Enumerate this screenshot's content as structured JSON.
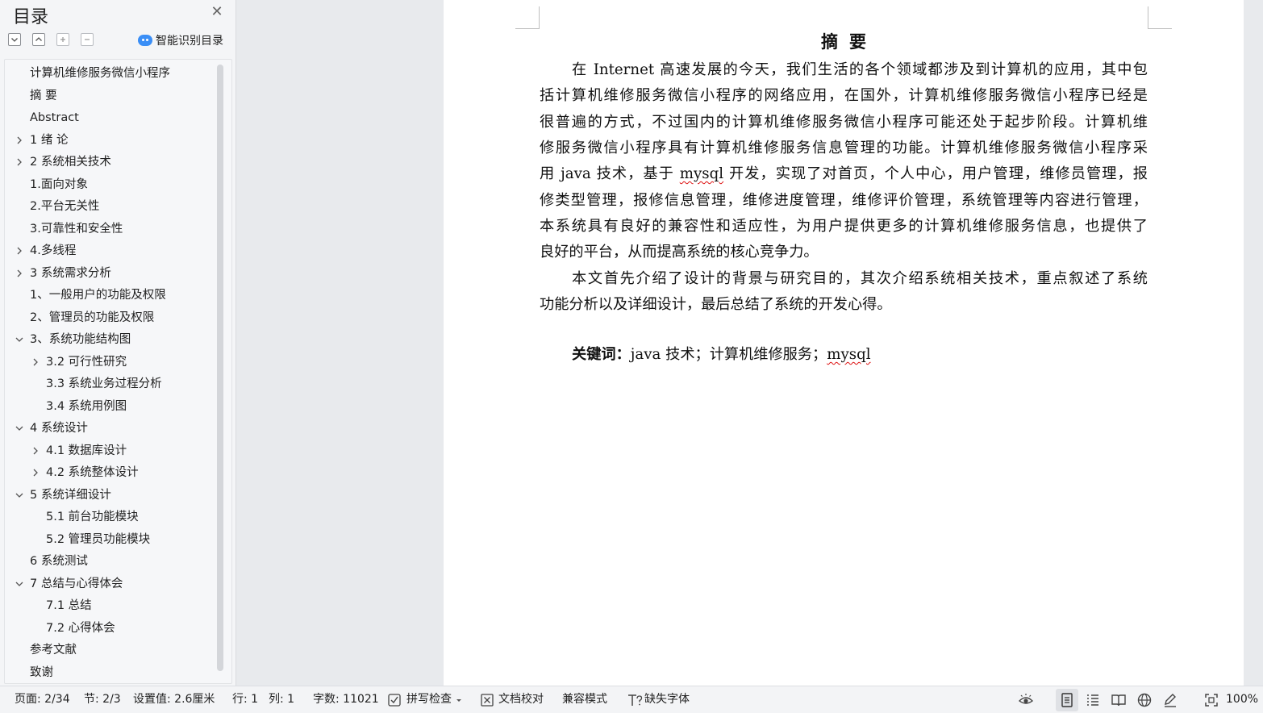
{
  "toc_panel": {
    "title": "目录",
    "smart_toc_label": "智能识别目录",
    "items": [
      {
        "label": "计算机维修服务微信小程序",
        "expander": "none"
      },
      {
        "label": "摘  要",
        "expander": "none"
      },
      {
        "label": "Abstract",
        "expander": "none"
      },
      {
        "label": "1  绪  论",
        "expander": "collapsed"
      },
      {
        "label": "2 系统相关技术",
        "expander": "collapsed"
      },
      {
        "label": "1.面向对象",
        "expander": "none"
      },
      {
        "label": "2.平台无关性",
        "expander": "none"
      },
      {
        "label": "3.可靠性和安全性",
        "expander": "none"
      },
      {
        "label": "4.多线程",
        "expander": "collapsed"
      },
      {
        "label": "3 系统需求分析",
        "expander": "collapsed"
      },
      {
        "label": "1、一般用户的功能及权限",
        "expander": "none"
      },
      {
        "label": "2、管理员的功能及权限",
        "expander": "none"
      },
      {
        "label": "3、系统功能结构图",
        "expander": "expanded"
      },
      {
        "label": "3.2 可行性研究",
        "expander": "collapsed"
      },
      {
        "label": "3.3 系统业务过程分析",
        "expander": "none"
      },
      {
        "label": "3.4 系统用例图",
        "expander": "none"
      },
      {
        "label": "4 系统设计",
        "expander": "expanded"
      },
      {
        "label": "4.1 数据库设计",
        "expander": "collapsed"
      },
      {
        "label": "4.2 系统整体设计",
        "expander": "collapsed"
      },
      {
        "label": "5 系统详细设计",
        "expander": "expanded"
      },
      {
        "label": "5.1 前台功能模块",
        "expander": "none"
      },
      {
        "label": "5.2 管理员功能模块",
        "expander": "none"
      },
      {
        "label": "6 系统测试",
        "expander": "none"
      },
      {
        "label": "7 总结与心得体会",
        "expander": "expanded"
      },
      {
        "label": "7.1  总结",
        "expander": "none"
      },
      {
        "label": "7.2  心得体会",
        "expander": "none"
      },
      {
        "label": "参考文献",
        "expander": "none"
      },
      {
        "label": "致谢",
        "expander": "none"
      }
    ]
  },
  "document": {
    "heading": "摘要",
    "lines": [
      [
        "在 Internet 高速发展的今天，我们生活的各个领域都涉及到计算机的应用，其中包"
      ],
      [
        "括计算机维修服务微信小程序的网络应用，在国外，计算机维修服务微信小程序已经是"
      ],
      [
        "很普遍的方式，不过国内的计算机维修服务微信小程序可能还处于起步阶段。计算机维"
      ],
      [
        "修服务微信小程序具有计算机维修服务信息管理的功能。计算机维修服务微信小程序采"
      ],
      [
        "用 java 技术，基于 ",
        "mysql",
        " 开发，实现了对首页，个人中心，用户管理，维修员管理，报"
      ],
      [
        "修类型管理，报修信息管理，维修进度管理，维修评价管理，系统管理等内容进行管理，"
      ],
      [
        "本系统具有良好的兼容性和适应性，为用户提供更多的计算机维修服务信息，也提供了"
      ],
      [
        "良好的平台，从而提高系统的核心竞争力。"
      ],
      [
        "本文首先介绍了设计的背景与研究目的，其次介绍系统相关技术，重点叙述了系统"
      ],
      [
        "功能分析以及详细设计，最后总结了系统的开发心得。"
      ]
    ],
    "keywords_label": "关键词：",
    "keywords_text": "java 技术；计算机维修服务；",
    "keywords_spell": "mysql"
  },
  "status_bar": {
    "page": "页面: 2/34",
    "section": "节: 2/3",
    "setting": "设置值: 2.6厘米",
    "row": "行: 1",
    "col": "列: 1",
    "word_count": "字数: 11021",
    "spell_check": "拼写检查",
    "proofread": "文档校对",
    "compat_mode": "兼容模式",
    "missing_font": "缺失字体",
    "zoom": "100%"
  }
}
